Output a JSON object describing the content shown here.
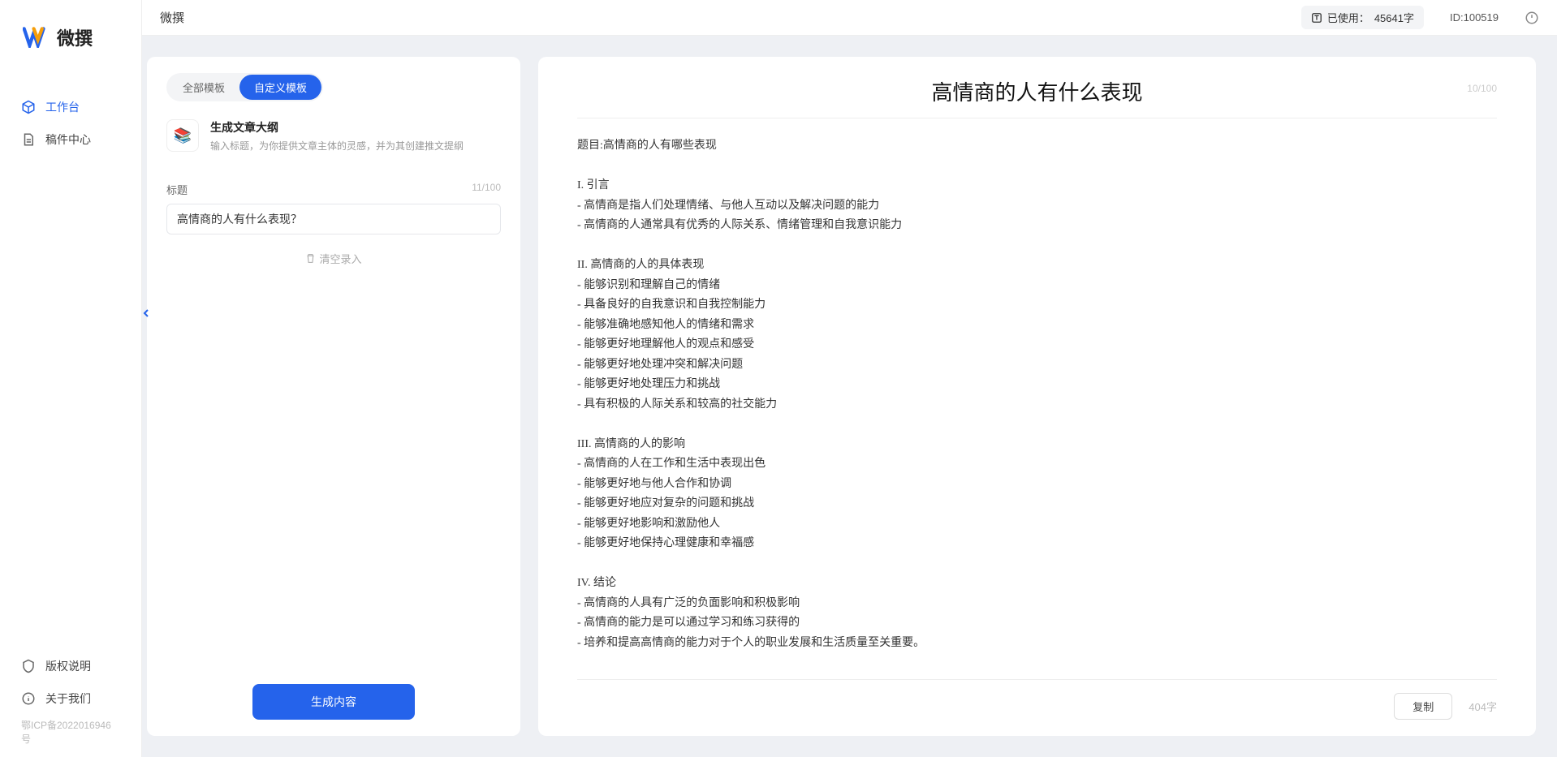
{
  "app": {
    "name": "微撰",
    "topbar_title": "微撰"
  },
  "usage": {
    "label": "已使用：",
    "value": "45641字"
  },
  "user": {
    "id_label": "ID:",
    "id": "100519"
  },
  "sidebar": {
    "nav": [
      {
        "label": "工作台",
        "active": true,
        "name": "nav-workspace"
      },
      {
        "label": "稿件中心",
        "active": false,
        "name": "nav-drafts"
      }
    ],
    "footer": [
      {
        "label": "版权说明",
        "name": "footer-copyright"
      },
      {
        "label": "关于我们",
        "name": "footer-about"
      }
    ],
    "icp": "鄂ICP备2022016946号"
  },
  "tabs": {
    "all": "全部模板",
    "custom": "自定义模板"
  },
  "template": {
    "title": "生成文章大纲",
    "desc": "输入标题，为你提供文章主体的灵感，并为其创建推文提纲"
  },
  "form": {
    "title_label": "标题",
    "title_counter": "11/100",
    "title_value": "高情商的人有什么表现？",
    "clear_label": "清空录入",
    "generate_label": "生成内容"
  },
  "output": {
    "title": "高情商的人有什么表现",
    "title_counter": "10/100",
    "body": "题目:高情商的人有哪些表现\n\nI. 引言\n- 高情商是指人们处理情绪、与他人互动以及解决问题的能力\n- 高情商的人通常具有优秀的人际关系、情绪管理和自我意识能力\n\nII. 高情商的人的具体表现\n- 能够识别和理解自己的情绪\n- 具备良好的自我意识和自我控制能力\n- 能够准确地感知他人的情绪和需求\n- 能够更好地理解他人的观点和感受\n- 能够更好地处理冲突和解决问题\n- 能够更好地处理压力和挑战\n- 具有积极的人际关系和较高的社交能力\n\nIII. 高情商的人的影响\n- 高情商的人在工作和生活中表现出色\n- 能够更好地与他人合作和协调\n- 能够更好地应对复杂的问题和挑战\n- 能够更好地影响和激励他人\n- 能够更好地保持心理健康和幸福感\n\nIV. 结论\n- 高情商的人具有广泛的负面影响和积极影响\n- 高情商的能力是可以通过学习和练习获得的\n- 培养和提高高情商的能力对于个人的职业发展和生活质量至关重要。",
    "copy_label": "复制",
    "word_count": "404字"
  }
}
